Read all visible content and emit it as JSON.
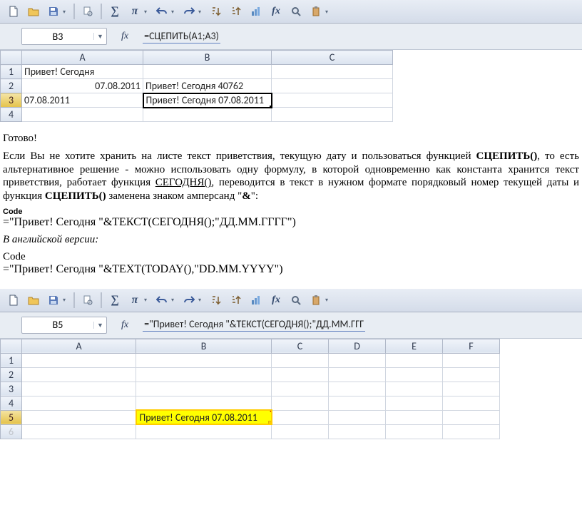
{
  "screenshot1": {
    "namebox": "B3",
    "fx_label": "fx",
    "formula": "=СЦЕПИТЬ(A1;A3)",
    "columns": [
      "A",
      "B",
      "C"
    ],
    "rows": [
      {
        "n": "1",
        "A": "Привет! Сегодня",
        "B": ""
      },
      {
        "n": "2",
        "A": "07.08.2011",
        "B": "Привет! Сегодня 40762"
      },
      {
        "n": "3",
        "A": "07.08.2011",
        "B": "Привет! Сегодня 07.08.2011"
      },
      {
        "n": "4",
        "A": "",
        "B": ""
      }
    ]
  },
  "article": {
    "done": "Готово!",
    "p1a": "Если Вы не хотите хранить на листе текст приветствия, текущую дату и пользоваться функцией ",
    "p1b": "СЦЕПИТЬ()",
    "p1c": ", то есть альтернативное решение - можно использовать одну формулу, в которой одновременно как константа хранится текст приветствия, работает функция ",
    "p1d": "СЕГОДНЯ()",
    "p1e": ", переводится в текст в нужном формате порядковый номер текущей даты и функция ",
    "p1f": "СЦЕПИТЬ()",
    "p1g": " заменена знаком амперсанд \"",
    "p1h": "&",
    "p1i": "\":",
    "code_lbl": "Code",
    "code1": "=\"Привет! Сегодня \"&ТЕКСТ(СЕГОДНЯ();\"ДД.ММ.ГГГГ\")",
    "en_version": "В английской версии:",
    "code2": "=\"Привет! Сегодня \"&TEXT(TODAY(),\"DD.MM.YYYY\")"
  },
  "screenshot2": {
    "namebox": "B5",
    "fx_label": "fx",
    "formula": "=\"Привет! Сегодня \"&ТЕКСТ(СЕГОДНЯ();\"ДД.ММ.ГГГ",
    "columns": [
      "A",
      "B",
      "C",
      "D",
      "E",
      "F"
    ],
    "rows": [
      {
        "n": "1"
      },
      {
        "n": "2"
      },
      {
        "n": "3"
      },
      {
        "n": "4"
      },
      {
        "n": "5",
        "B": "Привет! Сегодня 07.08.2011"
      },
      {
        "n": "6"
      }
    ]
  },
  "icons": {
    "sigma": "Σ",
    "pi": "π",
    "fx": "fx",
    "sum": "∑"
  }
}
